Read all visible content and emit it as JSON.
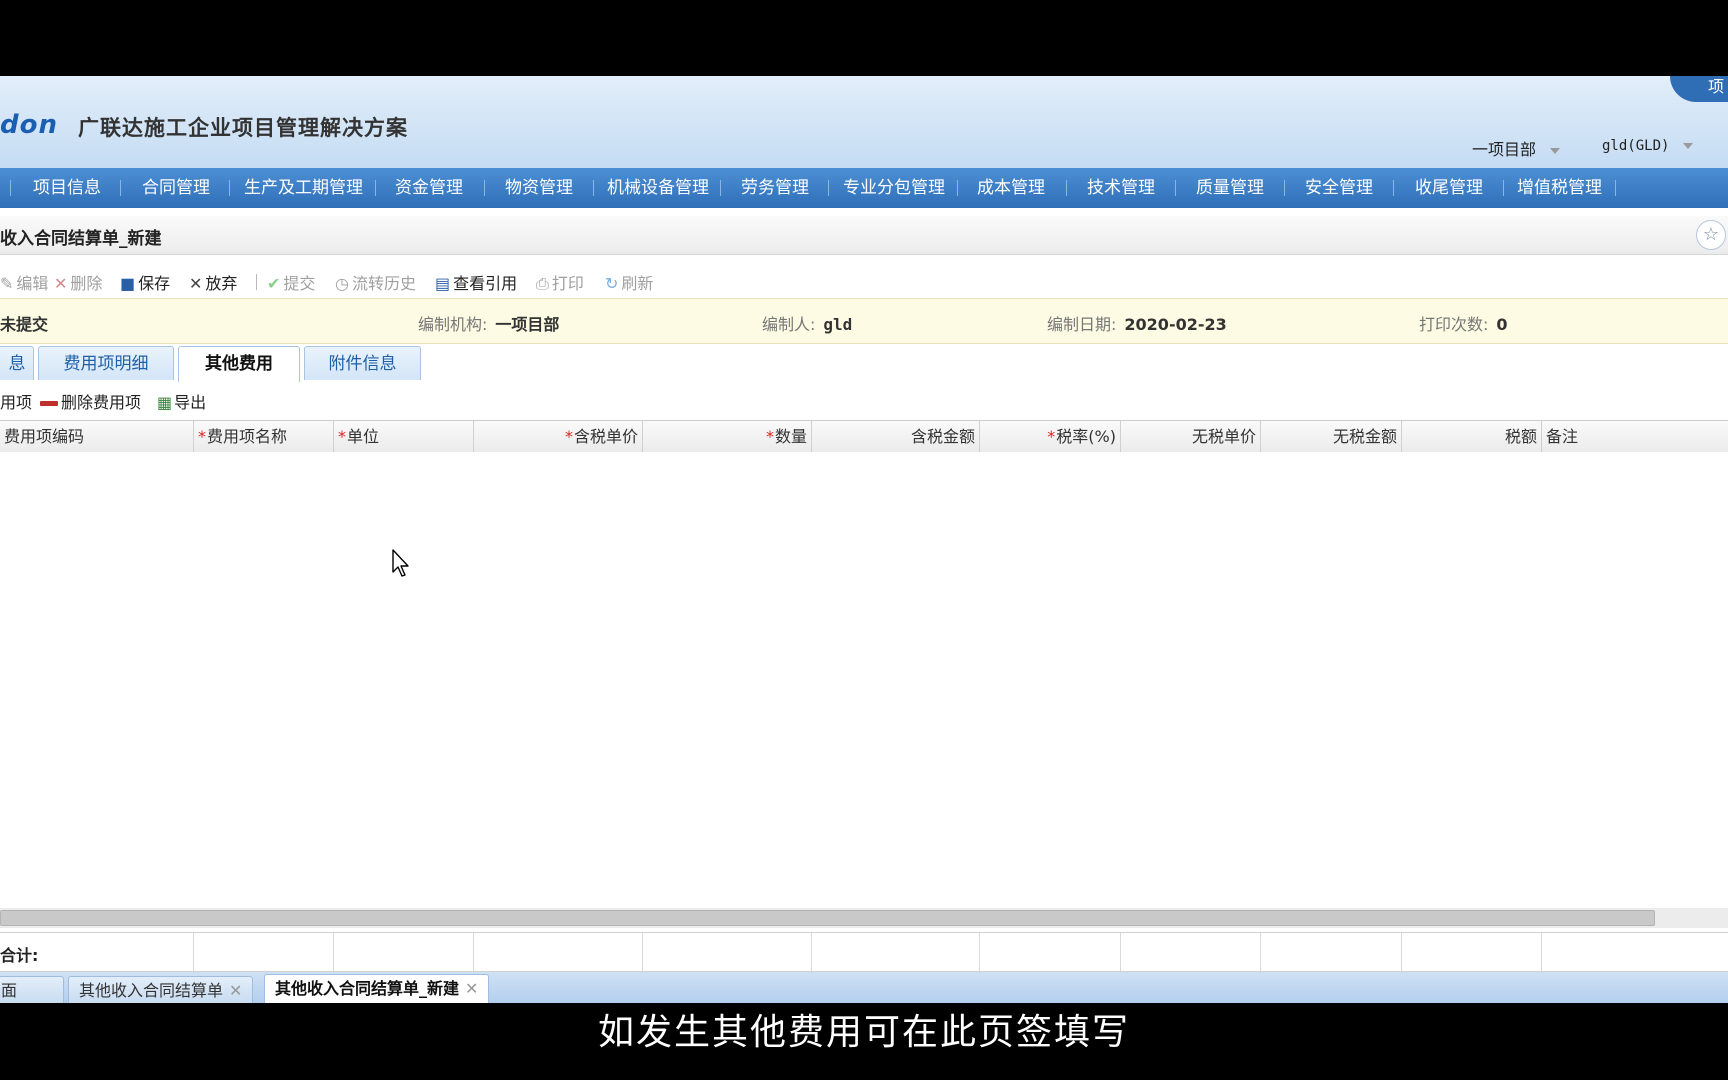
{
  "brand": {
    "logo_mark": "don",
    "logo_text": "广联达施工企业项目管理解决方案",
    "corner_label": "项"
  },
  "header": {
    "org": "一项目部",
    "user": "gld(GLD)"
  },
  "nav": [
    "项目信息",
    "合同管理",
    "生产及工期管理",
    "资金管理",
    "物资管理",
    "机械设备管理",
    "劳务管理",
    "专业分包管理",
    "成本管理",
    "技术管理",
    "质量管理",
    "安全管理",
    "收尾管理",
    "增值税管理"
  ],
  "page_title": "收入合同结算单_新建",
  "toolbar": {
    "edit": "编辑",
    "delete": "删除",
    "save": "保存",
    "discard": "放弃",
    "submit": "提交",
    "history": "流转历史",
    "view_ref": "查看引用",
    "print": "打印",
    "refresh": "刷新"
  },
  "info": {
    "status": "未提交",
    "org_label": "编制机构:",
    "org_value": "一项目部",
    "author_label": "编制人:",
    "author_value": "gld",
    "date_label": "编制日期:",
    "date_value": "2020-02-23",
    "prints_label": "打印次数:",
    "prints_value": "0"
  },
  "tabs": [
    "息",
    "费用项明细",
    "其他费用",
    "附件信息"
  ],
  "subbar": {
    "add": "用项",
    "remove": "删除费用项",
    "export": "导出"
  },
  "columns": [
    {
      "label": "费用项编码",
      "req": false
    },
    {
      "label": "费用项名称",
      "req": true
    },
    {
      "label": "单位",
      "req": true
    },
    {
      "label": "含税单价",
      "req": true
    },
    {
      "label": "数量",
      "req": true
    },
    {
      "label": "含税金额",
      "req": false
    },
    {
      "label": "税率(%)",
      "req": true
    },
    {
      "label": "无税单价",
      "req": false
    },
    {
      "label": "无税金额",
      "req": false
    },
    {
      "label": "税额",
      "req": false
    },
    {
      "label": "备注",
      "req": false
    }
  ],
  "totals_label": "合计:",
  "bottom_tabs": [
    "面",
    "其他收入合同结算单",
    "其他收入合同结算单_新建"
  ],
  "subtitle": "如发生其他费用可在此页签填写"
}
